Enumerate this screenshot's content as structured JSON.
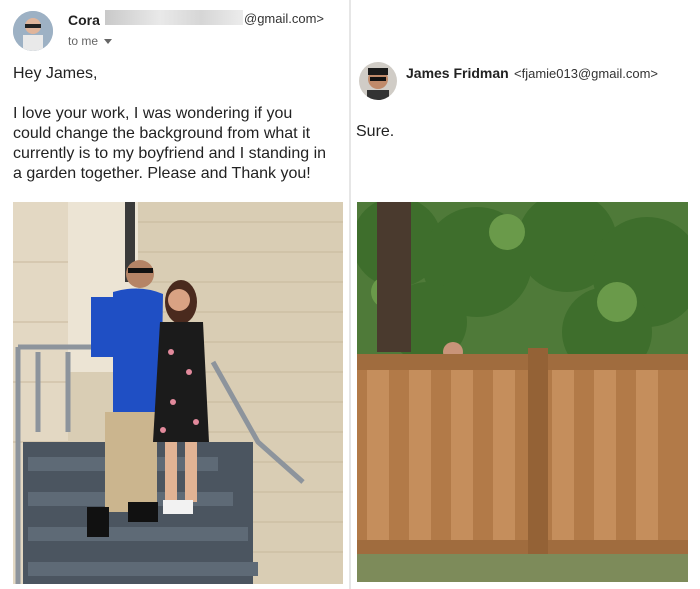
{
  "left_email": {
    "sender_name": "Cora",
    "sender_email_suffix": "@gmail.com>",
    "recipient_line": "to me",
    "greeting": "Hey James,",
    "body_lines": [
      "I love your work, I was wondering if you",
      "could change the background from what it",
      "currently is to my boyfriend and I standing in",
      "a garden together. Please and Thank you!"
    ]
  },
  "right_email": {
    "sender_name": "James Fridman",
    "sender_email": "<fjamie013@gmail.com>",
    "reply": "Sure."
  },
  "icons": {
    "caret": "chevron-down-icon"
  },
  "colors": {
    "separator": "#e6e6e6",
    "fence": "#b27a48",
    "foliage": "#3e6e2c",
    "shirt": "#1f4fc4"
  }
}
